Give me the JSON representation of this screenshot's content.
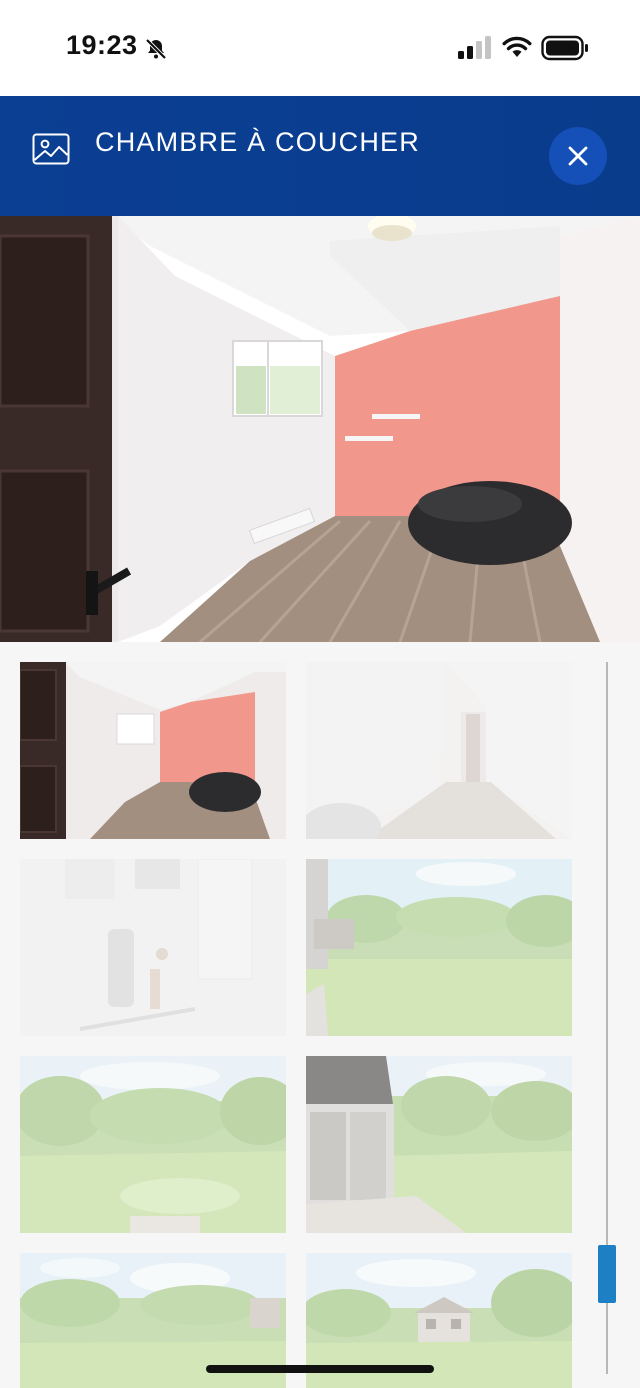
{
  "status_bar": {
    "time": "19:23",
    "icons": [
      "bell-slash-icon",
      "cellular-signal-icon",
      "wifi-icon",
      "battery-icon"
    ]
  },
  "header": {
    "title": "CHAMBRE À COUCHER",
    "icon": "photo-icon",
    "close_icon": "close-icon",
    "background": "#0b3f93"
  },
  "main_photo": {
    "subject": "bedroom"
  },
  "gallery": {
    "thumbnails": [
      {
        "subject": "bedroom",
        "selected": true
      },
      {
        "subject": "hallway",
        "selected": false
      },
      {
        "subject": "utility-room",
        "selected": false
      },
      {
        "subject": "backyard",
        "selected": false
      },
      {
        "subject": "backyard",
        "selected": false
      },
      {
        "subject": "patio",
        "selected": false
      },
      {
        "subject": "backyard",
        "selected": false
      },
      {
        "subject": "house-exterior",
        "selected": false
      }
    ],
    "scroll_accent": "#1d7fc4"
  }
}
